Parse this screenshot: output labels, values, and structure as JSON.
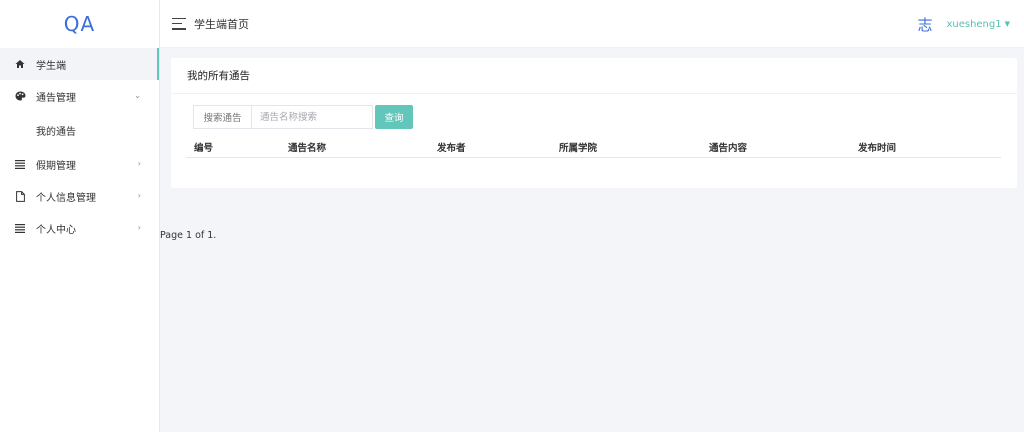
{
  "logo": "QA",
  "header": {
    "title": "学生端首页",
    "avatar_char": "志",
    "username": "xuesheng1"
  },
  "sidebar": {
    "items": [
      {
        "label": "学生端",
        "icon": "home-icon"
      },
      {
        "label": "通告管理",
        "icon": "palette-icon"
      },
      {
        "label": "我的通告"
      },
      {
        "label": "假期管理",
        "icon": "list-icon"
      },
      {
        "label": "个人信息管理",
        "icon": "file-icon"
      },
      {
        "label": "个人中心",
        "icon": "list-icon"
      }
    ]
  },
  "panel": {
    "title": "我的所有通告",
    "search": {
      "addon": "搜索通告",
      "placeholder": "通告名称搜索",
      "button": "查询"
    },
    "columns": [
      "编号",
      "通告名称",
      "发布者",
      "所属学院",
      "通告内容",
      "发布时间"
    ]
  },
  "pager": "Page 1 of 1."
}
